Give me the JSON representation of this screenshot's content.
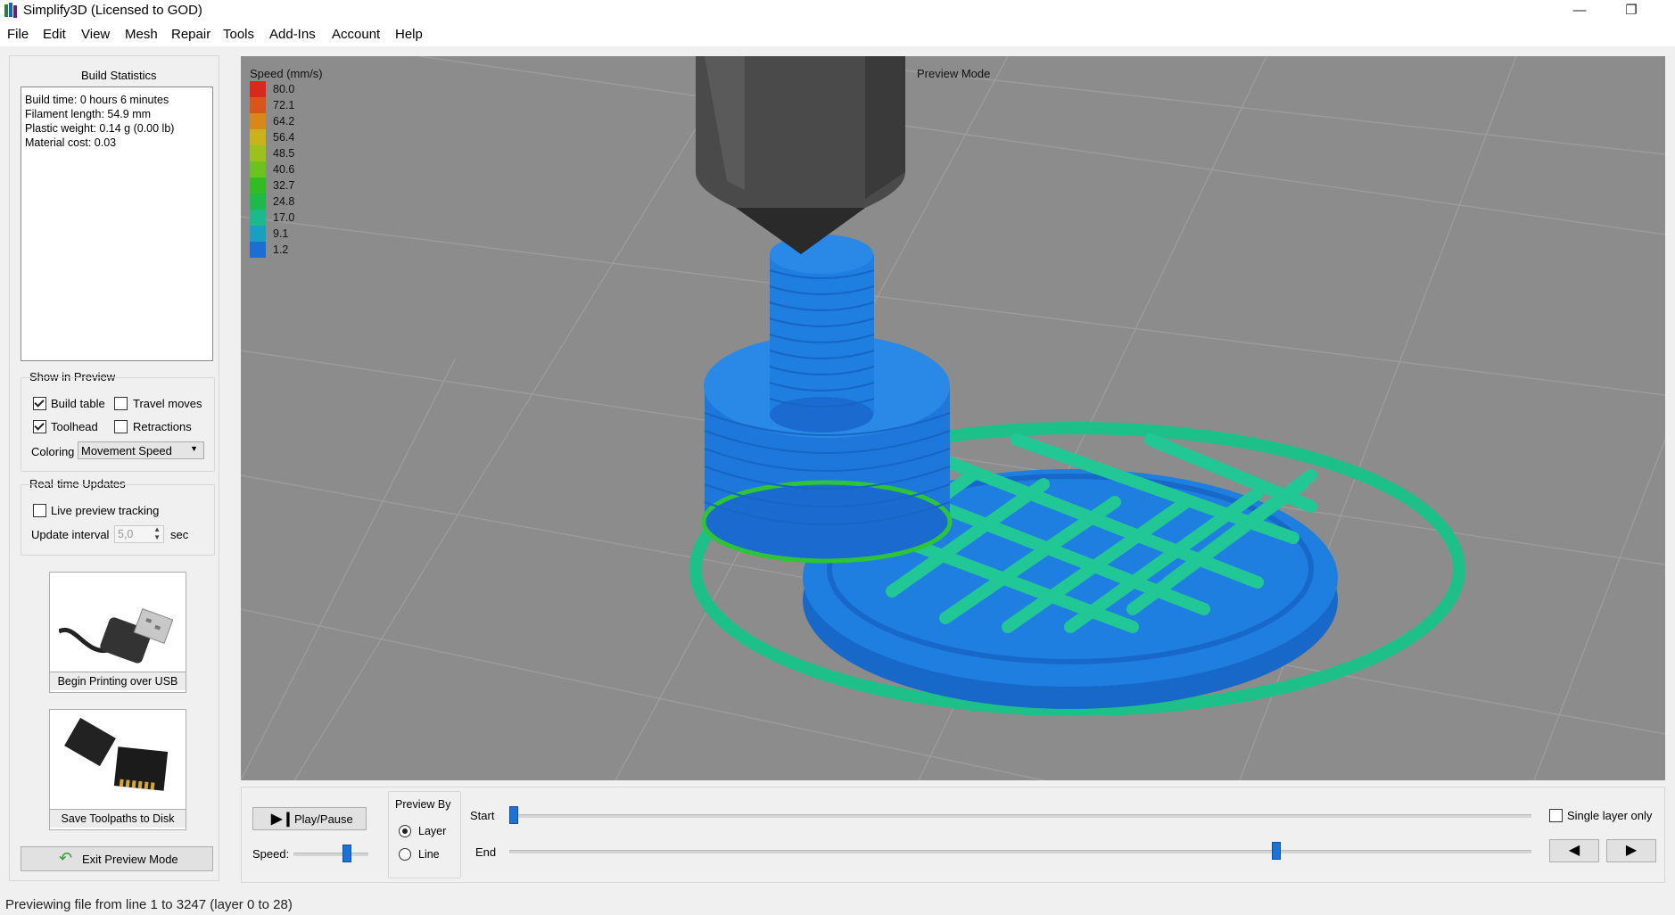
{
  "window": {
    "title": "Simplify3D (Licensed to GOD)",
    "minimize": "—",
    "restore": "❐"
  },
  "menu": [
    "File",
    "Edit",
    "View",
    "Mesh",
    "Repair",
    "Tools",
    "Add-Ins",
    "Account",
    "Help"
  ],
  "build_stats": {
    "title": "Build Statistics",
    "lines": [
      "Build time: 0 hours 6 minutes",
      "Filament length: 54.9 mm",
      "Plastic weight: 0.14 g (0.00 lb)",
      "Material cost: 0.03"
    ]
  },
  "show_in_preview": {
    "title": "Show in Preview",
    "build_table": {
      "label": "Build table",
      "checked": true
    },
    "travel_moves": {
      "label": "Travel moves",
      "checked": false
    },
    "toolhead": {
      "label": "Toolhead",
      "checked": true
    },
    "retractions": {
      "label": "Retractions",
      "checked": false
    },
    "coloring_label": "Coloring",
    "coloring_value": "Movement Speed"
  },
  "realtime": {
    "title": "Real-time Updates",
    "live_tracking": {
      "label": "Live preview tracking",
      "checked": false
    },
    "interval_label": "Update interval",
    "interval_value": "5,0",
    "interval_unit": "sec"
  },
  "actions": {
    "usb_label": "Begin Printing over USB",
    "disk_label": "Save Toolpaths to Disk",
    "exit_label": "Exit Preview Mode"
  },
  "viewport": {
    "legend_title": "Speed (mm/s)",
    "legend": [
      {
        "value": "80.0",
        "color": "#d62a1e"
      },
      {
        "value": "72.1",
        "color": "#d8561c"
      },
      {
        "value": "64.2",
        "color": "#d9861a"
      },
      {
        "value": "56.4",
        "color": "#c8b31c"
      },
      {
        "value": "48.5",
        "color": "#9cc11c"
      },
      {
        "value": "40.6",
        "color": "#6cc21e"
      },
      {
        "value": "32.7",
        "color": "#32bb22"
      },
      {
        "value": "24.8",
        "color": "#1eb94a"
      },
      {
        "value": "17.0",
        "color": "#1db98c"
      },
      {
        "value": "9.1",
        "color": "#1a9fc0"
      },
      {
        "value": "1.2",
        "color": "#1a6fd0"
      }
    ],
    "mode_label": "Preview Mode"
  },
  "playback": {
    "play_label": "Play/Pause",
    "speed_label": "Speed:",
    "speed_level": 0.72,
    "preview_by_title": "Preview By",
    "layer_label": "Layer",
    "line_label": "Line",
    "preview_by": "Layer",
    "start_label": "Start",
    "end_label": "End",
    "start_level": 0.0,
    "end_level": 0.75,
    "single_layer_label": "Single layer only",
    "single_layer_checked": false
  },
  "status": {
    "text": "Previewing file from line 1 to 3247 (layer 0 to 28)"
  }
}
